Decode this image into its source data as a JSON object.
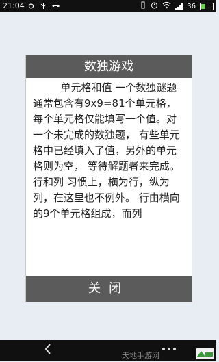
{
  "status_bar": {
    "time": "21:04",
    "battery": "36"
  },
  "dialog": {
    "title": "数独游戏",
    "body": "单元格和值 一个数独谜题通常包含有9x9=81个单元格， 每个单元格仅能填写一个值。对一个未完成的数独题， 有些单元格中已经填入了值，另外的单元格则为空， 等待解题者来完成。　　行和列 习惯上，横为行，纵为列，在这里也不例外。 行由横向的9个单元格组成，而列",
    "close_label": "关闭"
  },
  "watermark": {
    "text": "天地手游网"
  },
  "icons": {
    "nav_back": "chevron-left-icon",
    "nav_more": "more-dots-icon",
    "status": [
      "debug-icon",
      "usb-icon",
      "wifi-icon",
      "signal-icon",
      "battery-icon"
    ]
  },
  "colors": {
    "dialog_header": "#5b5b5b",
    "background": "#e7edf2",
    "battery_fill": "#6bd14e"
  }
}
